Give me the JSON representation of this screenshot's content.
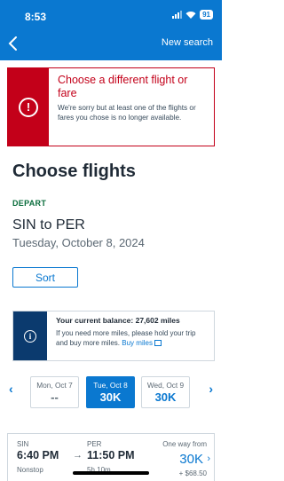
{
  "status_bar": {
    "time": "8:53",
    "battery": "91"
  },
  "nav": {
    "back_icon": "chevron-left-icon",
    "new_search": "New search"
  },
  "alert": {
    "icon": "exclamation-circle-icon",
    "title": "Choose a different flight or fare",
    "message": "We're sorry but at least one of the flights or fares you chose is no longer available.",
    "color": "#c30019"
  },
  "page": {
    "title": "Choose flights",
    "depart_label": "DEPART",
    "route": "SIN to PER",
    "date": "Tuesday, October 8, 2024",
    "sort_label": "Sort"
  },
  "balance": {
    "icon": "info-icon",
    "title": "Your current balance: 27,602 miles",
    "message": "If you need more miles, please hold your trip and buy more miles.",
    "link": "Buy miles"
  },
  "date_selector": {
    "days": [
      {
        "date": "Mon, Oct 7",
        "price": "--"
      },
      {
        "date": "Tue, Oct 8",
        "price": "30K",
        "selected": true
      },
      {
        "date": "Wed, Oct 9",
        "price": "30K"
      }
    ]
  },
  "flight": {
    "from_code": "SIN",
    "depart_time": "6:40 PM",
    "to_code": "PER",
    "arrive_time": "11:50 PM",
    "stops": "Nonstop",
    "duration": "5h 10m",
    "price_label": "One way from",
    "price": "30K",
    "fee": "+ $68.50"
  },
  "colors": {
    "brand_blue": "#0a78d0",
    "navy": "#0b3a6e",
    "error_red": "#c30019"
  }
}
